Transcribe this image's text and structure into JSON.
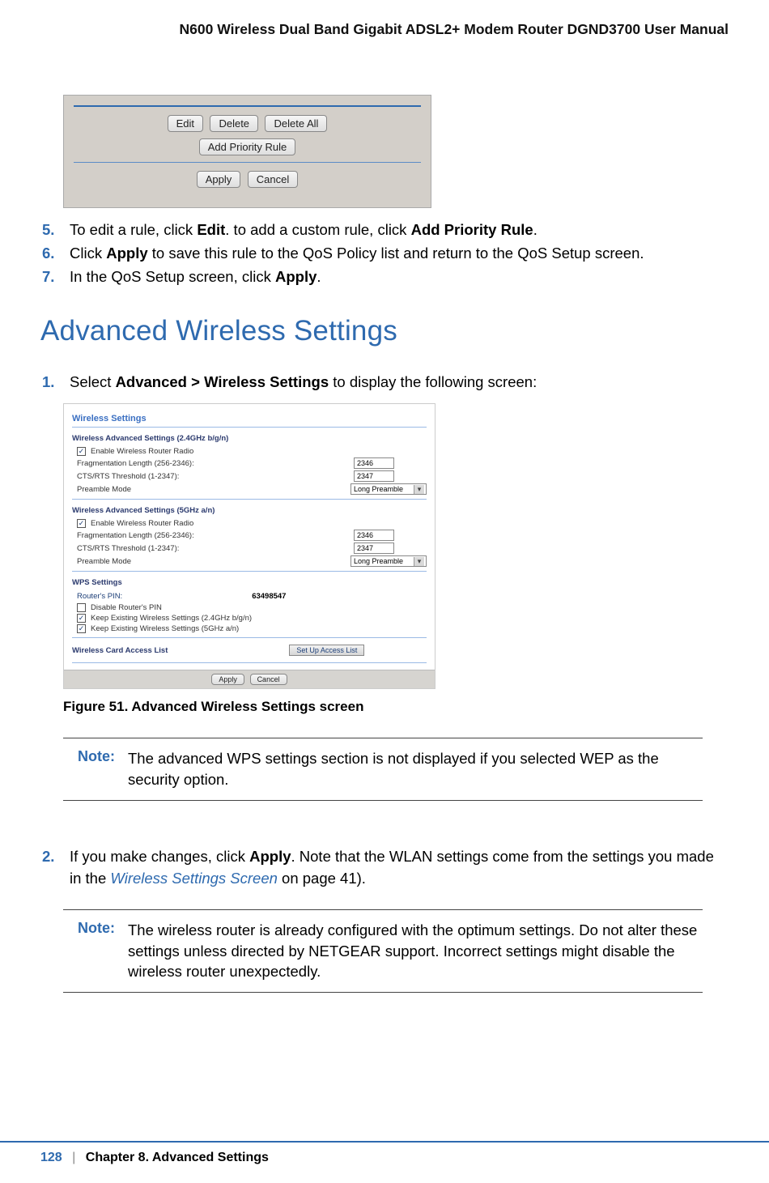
{
  "header": {
    "title": "N600 Wireless Dual Band Gigabit ADSL2+ Modem Router DGND3700 User Manual"
  },
  "panel1": {
    "buttons": {
      "edit": "Edit",
      "delete": "Delete",
      "delete_all": "Delete All",
      "add_rule": "Add Priority Rule",
      "apply": "Apply",
      "cancel": "Cancel"
    }
  },
  "steps_a": [
    {
      "num": "5.",
      "text_before": "To edit a rule, click ",
      "bold1": "Edit",
      "text_mid": ". to add a custom rule, click ",
      "bold2": "Add Priority Rule",
      "text_after": "."
    },
    {
      "num": "6.",
      "text_before": "Click ",
      "bold1": "Apply",
      "text_mid": " to save this rule to the QoS Policy list and return to the QoS Setup screen.",
      "bold2": "",
      "text_after": ""
    },
    {
      "num": "7.",
      "text_before": "In the QoS Setup screen, click ",
      "bold1": "Apply",
      "text_mid": ".",
      "bold2": "",
      "text_after": ""
    }
  ],
  "heading": "Advanced Wireless Settings",
  "steps_b_1": {
    "num": "1.",
    "text_before": "Select ",
    "bold": "Advanced > Wireless Settings",
    "text_after": " to display the following screen:"
  },
  "panel2": {
    "title": "Wireless Settings",
    "section24": {
      "heading": "Wireless Advanced Settings (2.4GHz b/g/n)",
      "enable": "Enable Wireless Router Radio",
      "frag_label": "Fragmentation Length (256-2346):",
      "frag_value": "2346",
      "cts_label": "CTS/RTS Threshold (1-2347):",
      "cts_value": "2347",
      "preamble_label": "Preamble Mode",
      "preamble_value": "Long Preamble"
    },
    "section5": {
      "heading": "Wireless Advanced Settings (5GHz a/n)",
      "enable": "Enable Wireless Router Radio",
      "frag_label": "Fragmentation Length (256-2346):",
      "frag_value": "2346",
      "cts_label": "CTS/RTS Threshold (1-2347):",
      "cts_value": "2347",
      "preamble_label": "Preamble Mode",
      "preamble_value": "Long Preamble"
    },
    "wps": {
      "heading": "WPS Settings",
      "pin_label": "Router's PIN:",
      "pin_value": "63498547",
      "disable": "Disable Router's PIN",
      "keep24": "Keep Existing Wireless Settings (2.4GHz b/g/n)",
      "keep5": "Keep Existing Wireless Settings (5GHz a/n)"
    },
    "access_list": {
      "label": "Wireless Card Access List",
      "button": "Set Up Access List"
    },
    "bottom": {
      "apply": "Apply",
      "cancel": "Cancel"
    }
  },
  "figure_caption": "Figure 51.  Advanced Wireless Settings screen",
  "note1": {
    "label": "Note:",
    "text": "The advanced WPS settings section is not displayed if you selected WEP as the security option."
  },
  "steps_b_2": {
    "num": "2.",
    "text_before": "If you make changes, click ",
    "bold": "Apply",
    "text_mid": ". Note that the WLAN settings come from the settings you made in the ",
    "link": "Wireless Settings Screen",
    "text_after": " on page 41)."
  },
  "note2": {
    "label": "Note:",
    "text": "The wireless router is already configured with the optimum settings. Do not alter these settings unless directed by NETGEAR support. Incorrect settings might disable the wireless router unexpectedly."
  },
  "footer": {
    "page_num": "128",
    "chapter": "Chapter 8.  Advanced Settings"
  }
}
